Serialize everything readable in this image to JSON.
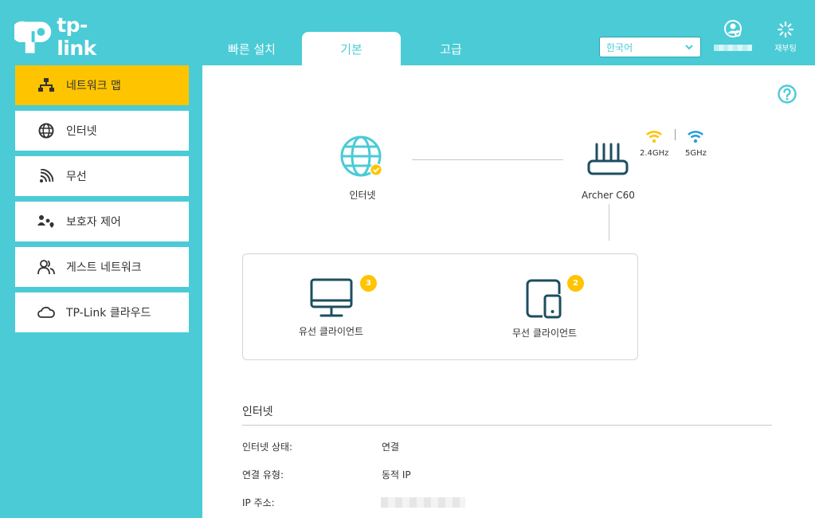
{
  "brand": {
    "name": "tp-link"
  },
  "tabs": [
    {
      "label": "빠른 설치"
    },
    {
      "label": "기본"
    },
    {
      "label": "고급"
    }
  ],
  "language": {
    "selected": "한국어"
  },
  "reboot": {
    "label": "재부팅"
  },
  "sidebar": {
    "items": [
      {
        "label": "네트워크 맵",
        "icon": "network-map-icon"
      },
      {
        "label": "인터넷",
        "icon": "globe-icon"
      },
      {
        "label": "무선",
        "icon": "wireless-icon"
      },
      {
        "label": "보호자 제어",
        "icon": "parental-control-icon"
      },
      {
        "label": "게스트 네트워크",
        "icon": "guest-users-icon"
      },
      {
        "label": "TP-Link 클라우드",
        "icon": "cloud-icon"
      }
    ]
  },
  "map": {
    "internet_label": "인터넷",
    "router_label": "Archer C60",
    "band_24": "2.4GHz",
    "band_5": "5GHz",
    "wired": {
      "label": "유선 클라이언트",
      "count": "3"
    },
    "wireless": {
      "label": "무선 클라이언트",
      "count": "2"
    }
  },
  "internet_section": {
    "title": "인터넷",
    "rows": [
      {
        "key": "인터넷 상태:",
        "value": "연결"
      },
      {
        "key": "연결 유형:",
        "value": "동적 IP"
      },
      {
        "key": "IP 주소:",
        "value": ""
      }
    ]
  },
  "colors": {
    "accent": "#4acbd6",
    "highlight": "#ffc400",
    "dark_icon": "#1d4e5f"
  }
}
